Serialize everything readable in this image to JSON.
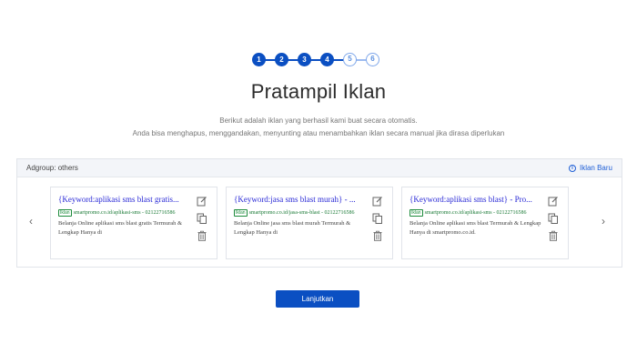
{
  "stepper": {
    "steps": [
      {
        "label": "1",
        "state": "done"
      },
      {
        "label": "2",
        "state": "done"
      },
      {
        "label": "3",
        "state": "done"
      },
      {
        "label": "4",
        "state": "done"
      },
      {
        "label": "5",
        "state": "todo"
      },
      {
        "label": "6",
        "state": "todo"
      }
    ],
    "done_color": "#0b4fc2",
    "todo_color": "#7fa7ea"
  },
  "header": {
    "title": "Pratampil Iklan",
    "subtitle_line1": "Berikut adalah iklan yang berhasil kami buat secara otomatis.",
    "subtitle_line2": "Anda bisa menghapus, menggandakan, menyunting atau menambahkan iklan secara manual jika dirasa diperlukan"
  },
  "panel": {
    "adgroup_label": "Adgroup: others",
    "new_ad_label": "Iklan Baru",
    "prev_arrow": "‹",
    "next_arrow": "›",
    "ads": [
      {
        "title": "{Keyword:aplikasi sms blast gratis...",
        "badge": "Iklan",
        "url": "smartpromo.co.id/aplikasi-sms - 02122716586",
        "description": "Belanja Online aplikasi sms blast gratis Termurah & Lengkap Hanya di"
      },
      {
        "title": "{Keyword:jasa sms blast murah} - ...",
        "badge": "Iklan",
        "url": "smartpromo.co.id/jasa-sms-blast - 02122716586",
        "description": "Belanja Online jasa sms blast murah Termurah & Lengkap Hanya di"
      },
      {
        "title": "{Keyword:aplikasi sms blast} - Pro...",
        "badge": "Iklan",
        "url": "smartpromo.co.id/aplikasi-sms - 02122716586",
        "description": "Belanja Online aplikasi sms blast Termurah & Lengkap Hanya di smartpromo.co.id."
      }
    ]
  },
  "footer": {
    "continue_label": "Lanjutkan"
  },
  "colors": {
    "accent": "#0b4fc2",
    "link": "#1f5fd6",
    "ad_title": "#2a2ad6",
    "ad_url": "#1a7a36"
  }
}
